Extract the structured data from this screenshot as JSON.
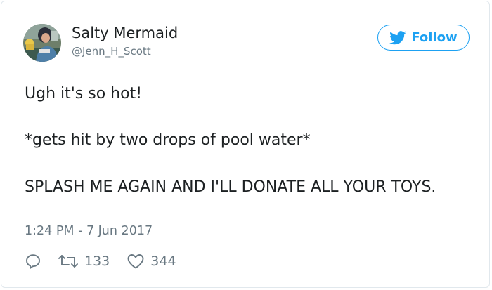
{
  "user": {
    "display_name": "Salty Mermaid",
    "handle": "@Jenn_H_Scott",
    "avatar_icon": "profile-photo"
  },
  "follow_button": {
    "label": "Follow",
    "icon": "twitter-bird-icon",
    "color": "#1da1f2"
  },
  "tweet": {
    "lines": [
      "Ugh it's so hot!",
      "*gets hit by two drops of pool water*",
      "SPLASH ME AGAIN AND I'LL DONATE ALL YOUR TOYS."
    ],
    "timestamp": "1:24 PM - 7 Jun 2017"
  },
  "actions": {
    "reply_icon": "reply-icon",
    "retweet_icon": "retweet-icon",
    "retweet_count": "133",
    "like_icon": "heart-icon",
    "like_count": "344"
  }
}
